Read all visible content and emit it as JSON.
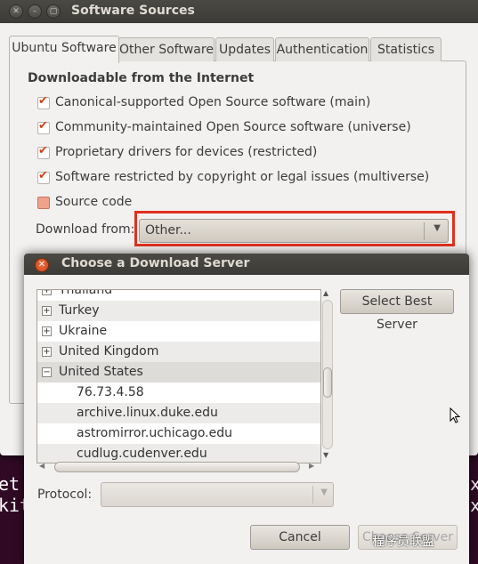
{
  "terminal": {
    "left_line1": "et",
    "left_line2": "kit",
    "right_line1": "ex",
    "right_line2": "ex"
  },
  "window": {
    "title": "Software Sources",
    "tabs": [
      "Ubuntu Software",
      "Other Software",
      "Updates",
      "Authentication",
      "Statistics"
    ],
    "section_title": "Downloadable from the Internet",
    "checkboxes": [
      {
        "label": "Canonical-supported Open Source software (main)",
        "checked": true
      },
      {
        "label": "Community-maintained Open Source software (universe)",
        "checked": true
      },
      {
        "label": "Proprietary drivers for devices (restricted)",
        "checked": true
      },
      {
        "label": "Software restricted by copyright or legal issues (multiverse)",
        "checked": true
      },
      {
        "label": "Source code",
        "checked": false
      }
    ],
    "download_from_label": "Download from:",
    "download_from_value": "Other..."
  },
  "dialog": {
    "title": "Choose a Download Server",
    "tree": [
      {
        "label": "Thailand",
        "type": "country",
        "expanded": false
      },
      {
        "label": "Turkey",
        "type": "country",
        "expanded": false
      },
      {
        "label": "Ukraine",
        "type": "country",
        "expanded": false
      },
      {
        "label": "United Kingdom",
        "type": "country",
        "expanded": false
      },
      {
        "label": "United States",
        "type": "country",
        "expanded": true
      },
      {
        "label": "76.73.4.58",
        "type": "server"
      },
      {
        "label": "archive.linux.duke.edu",
        "type": "server"
      },
      {
        "label": "astromirror.uchicago.edu",
        "type": "server"
      },
      {
        "label": "cudlug.cudenver.edu",
        "type": "server"
      }
    ],
    "select_best_label": "Select Best Server",
    "protocol_label": "Protocol:",
    "cancel_label": "Cancel",
    "choose_label": "Choose Server"
  },
  "watermark": "程序员联盟",
  "colors": {
    "highlight": "#e0301e",
    "checkbox_tick": "#d43e15",
    "titlebar": "#3c3b37"
  },
  "icons": [
    "close-icon",
    "minimize-icon",
    "maximize-icon",
    "expander-plus-icon",
    "expander-minus-icon",
    "dropdown-arrow-icon",
    "mouse-cursor-icon"
  ]
}
